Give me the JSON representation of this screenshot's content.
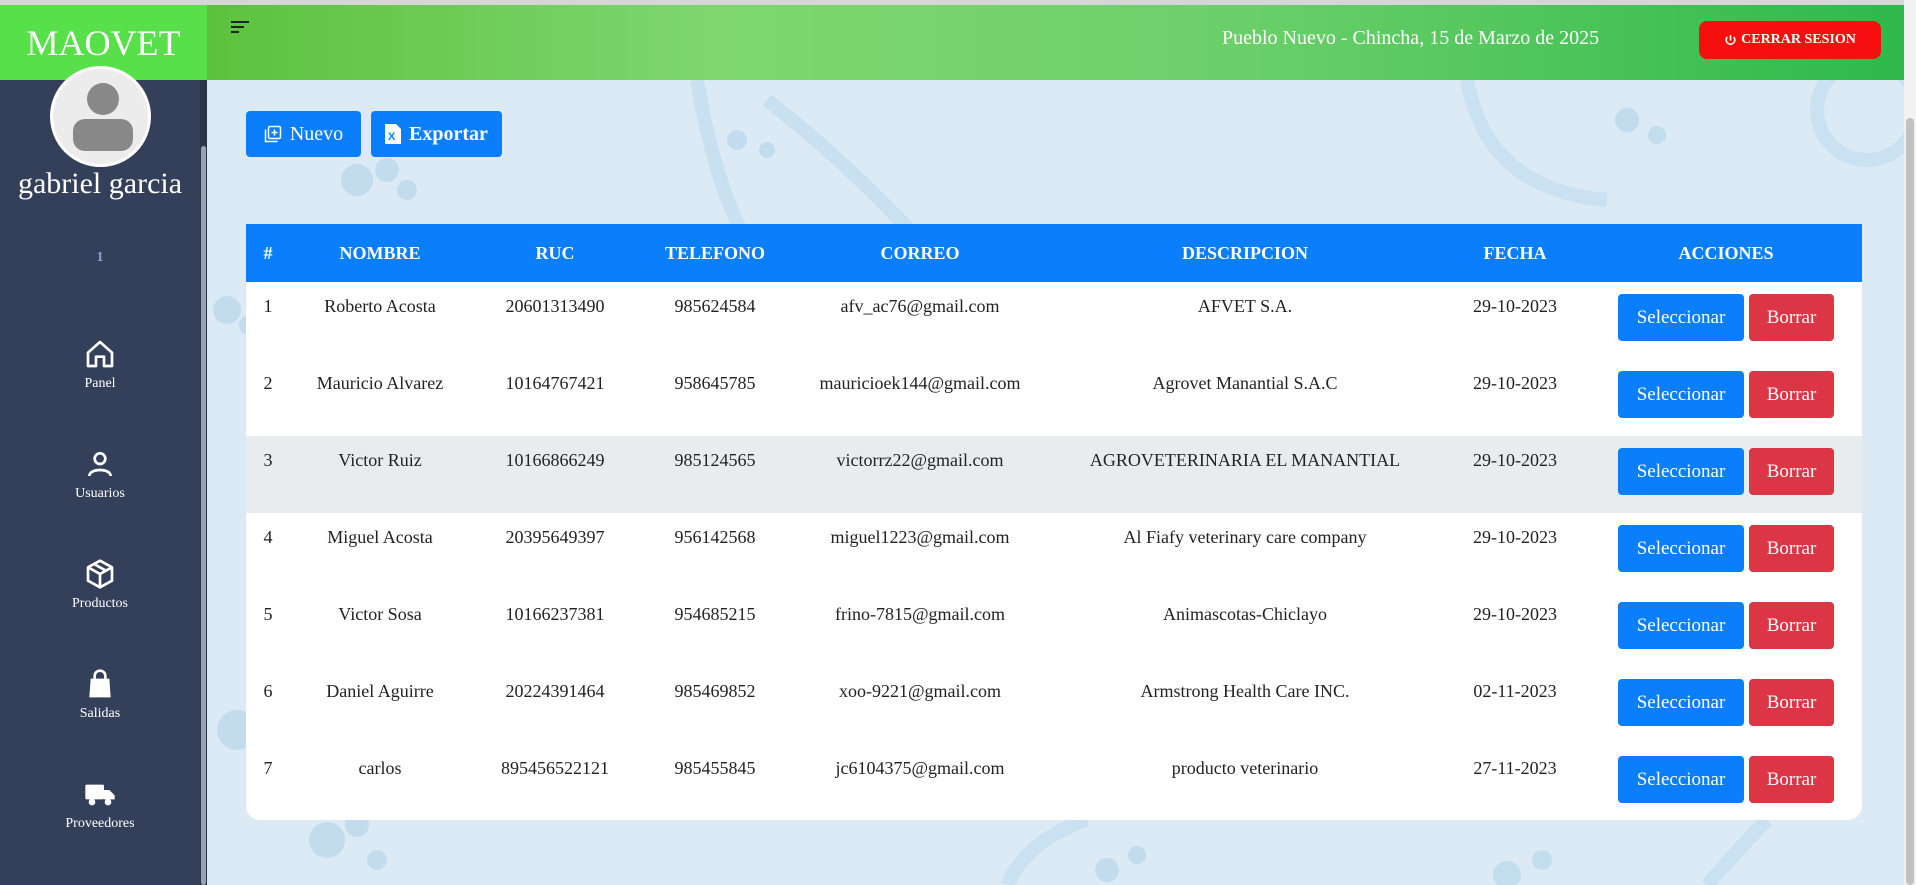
{
  "app": {
    "brand": "MAOVET"
  },
  "user": {
    "name": "gabriel garcia",
    "id": "1"
  },
  "nav": [
    {
      "label": "Panel",
      "icon": "home-icon"
    },
    {
      "label": "Usuarios",
      "icon": "user-icon"
    },
    {
      "label": "Productos",
      "icon": "box-icon"
    },
    {
      "label": "Salidas",
      "icon": "bag-icon"
    },
    {
      "label": "Proveedores",
      "icon": "truck-icon"
    }
  ],
  "header": {
    "date": "Pueblo Nuevo - Chincha, 15 de Marzo de 2025",
    "logout_label": "CERRAR SESION"
  },
  "toolbar": {
    "new_label": "Nuevo",
    "export_label": "Exportar"
  },
  "table": {
    "columns": [
      "#",
      "NOMBRE",
      "RUC",
      "TELEFONO",
      "CORREO",
      "DESCRIPCION",
      "FECHA",
      "ACCIONES"
    ],
    "rows": [
      [
        "1",
        "Roberto Acosta",
        "20601313490",
        "985624584",
        "afv_ac76@gmail.com",
        "AFVET S.A.",
        "29-10-2023"
      ],
      [
        "2",
        "Mauricio Alvarez",
        "10164767421",
        "958645785",
        "mauricioek144@gmail.com",
        "Agrovet Manantial S.A.C",
        "29-10-2023"
      ],
      [
        "3",
        "Victor Ruiz",
        "10166866249",
        "985124565",
        "victorrz22@gmail.com",
        "AGROVETERINARIA EL MANANTIAL",
        "29-10-2023"
      ],
      [
        "4",
        "Miguel Acosta",
        "20395649397",
        "956142568",
        "miguel1223@gmail.com",
        "Al Fiafy veterinary care company",
        "29-10-2023"
      ],
      [
        "5",
        "Victor Sosa",
        "10166237381",
        "954685215",
        "frino-7815@gmail.com",
        "Animascotas-Chiclayo",
        "29-10-2023"
      ],
      [
        "6",
        "Daniel Aguirre",
        "20224391464",
        "985469852",
        "xoo-9221@gmail.com",
        "Armstrong Health Care INC.",
        "02-11-2023"
      ],
      [
        "7",
        "carlos",
        "895456522121",
        "985455845",
        "jc6104375@gmail.com",
        "producto veterinario",
        "27-11-2023"
      ]
    ],
    "select_label": "Seleccionar",
    "delete_label": "Borrar"
  },
  "colors": {
    "primary": "#0b7ffb",
    "danger": "#dc3545",
    "sidebar": "#34405a",
    "brand": "#58e04a",
    "logout": "#f50f0f"
  }
}
